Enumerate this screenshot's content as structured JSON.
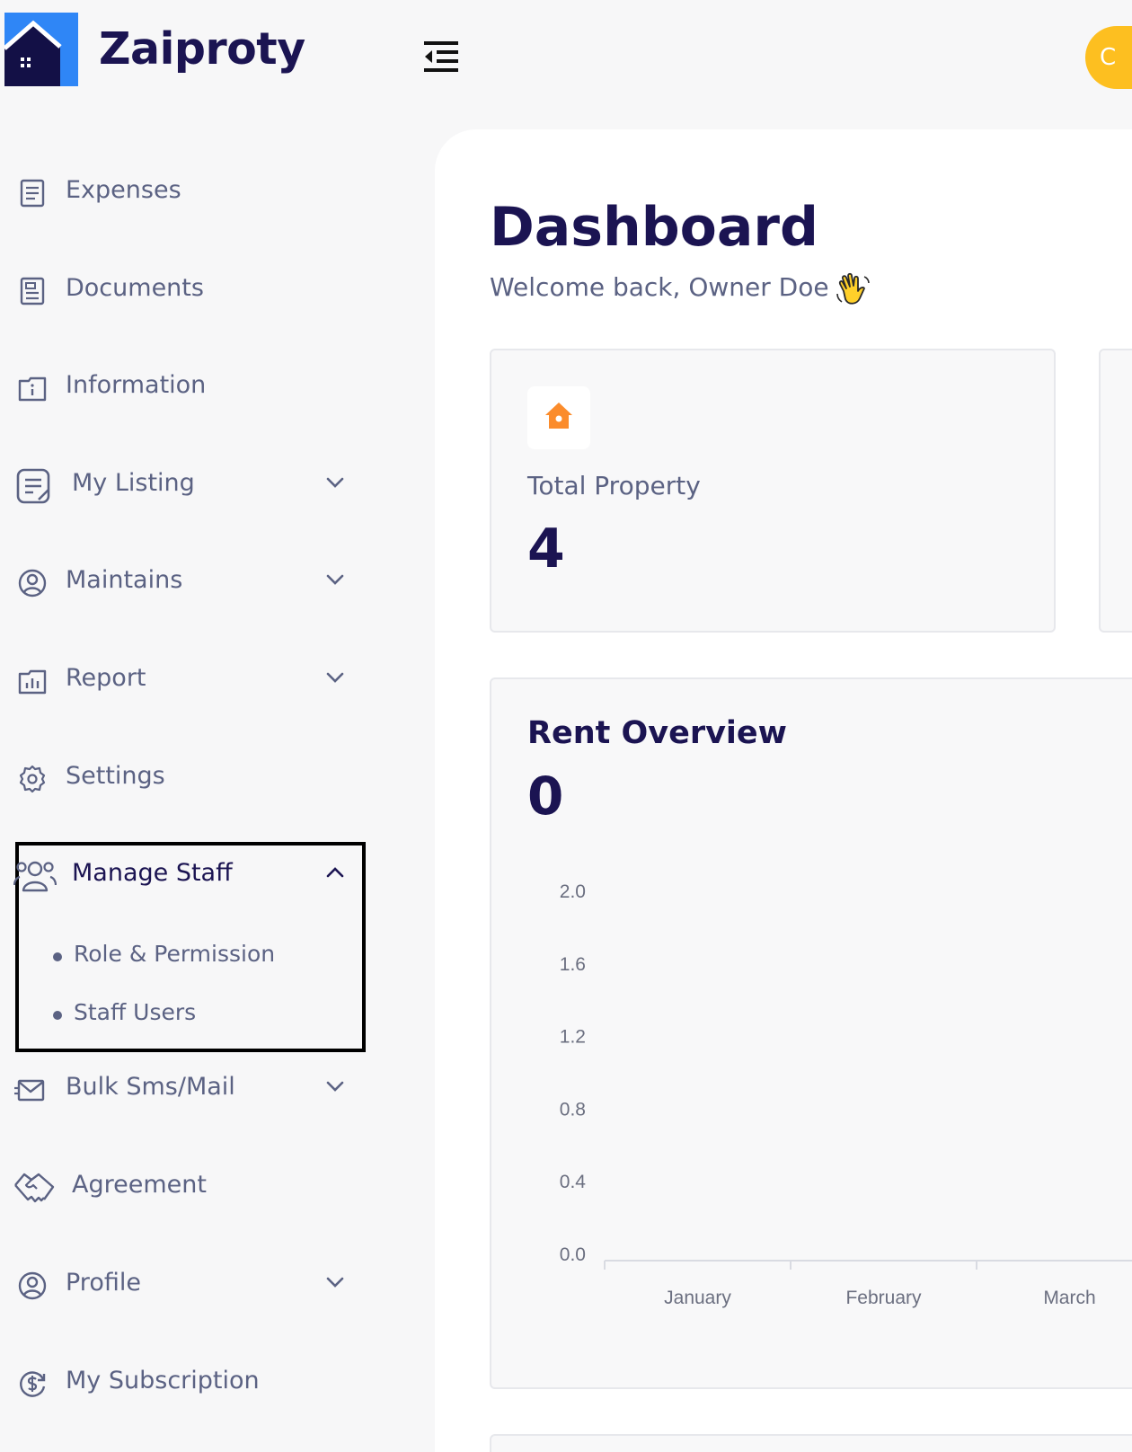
{
  "header": {
    "brand": "Zaiproty",
    "pill_text": "C"
  },
  "colors": {
    "navy": "#1b1452",
    "nav_text": "#5b6283",
    "accent_yellow": "#fdbf20",
    "logo_blue": "#2f86f6",
    "property_icon": "#fb8c2c"
  },
  "sidebar": {
    "items": [
      {
        "label": "Expenses",
        "icon": "expenses-icon",
        "has_submenu": false
      },
      {
        "label": "Documents",
        "icon": "documents-icon",
        "has_submenu": false
      },
      {
        "label": "Information",
        "icon": "information-icon",
        "has_submenu": false
      },
      {
        "label": "My Listing",
        "icon": "listing-icon",
        "has_submenu": true
      },
      {
        "label": "Maintains",
        "icon": "maintains-icon",
        "has_submenu": true
      },
      {
        "label": "Report",
        "icon": "report-icon",
        "has_submenu": true
      },
      {
        "label": "Settings",
        "icon": "gear-icon",
        "has_submenu": false
      },
      {
        "label": "Manage Staff",
        "icon": "staff-icon",
        "has_submenu": true,
        "expanded": true,
        "subitems": [
          {
            "label": "Role & Permission"
          },
          {
            "label": "Staff Users"
          }
        ]
      },
      {
        "label": "Bulk Sms/Mail",
        "icon": "mail-icon",
        "has_submenu": true
      },
      {
        "label": "Agreement",
        "icon": "handshake-icon",
        "has_submenu": false
      },
      {
        "label": "Profile",
        "icon": "profile-icon",
        "has_submenu": true
      },
      {
        "label": "My Subscription",
        "icon": "subscription-icon",
        "has_submenu": false
      }
    ]
  },
  "main": {
    "title": "Dashboard",
    "welcome": "Welcome back, Owner Doe",
    "stats": [
      {
        "label": "Total Property",
        "value": "4",
        "icon": "house-icon"
      }
    ],
    "rent_overview": {
      "title": "Rent Overview",
      "total": "0"
    }
  },
  "chart_data": {
    "type": "line",
    "title": "Rent Overview",
    "categories": [
      "January",
      "February",
      "March"
    ],
    "yticks": [
      "2.0",
      "1.6",
      "1.2",
      "0.8",
      "0.4",
      "0.0"
    ],
    "ylim": [
      0,
      2.0
    ],
    "values": [
      0,
      0,
      0
    ],
    "grid": false
  }
}
